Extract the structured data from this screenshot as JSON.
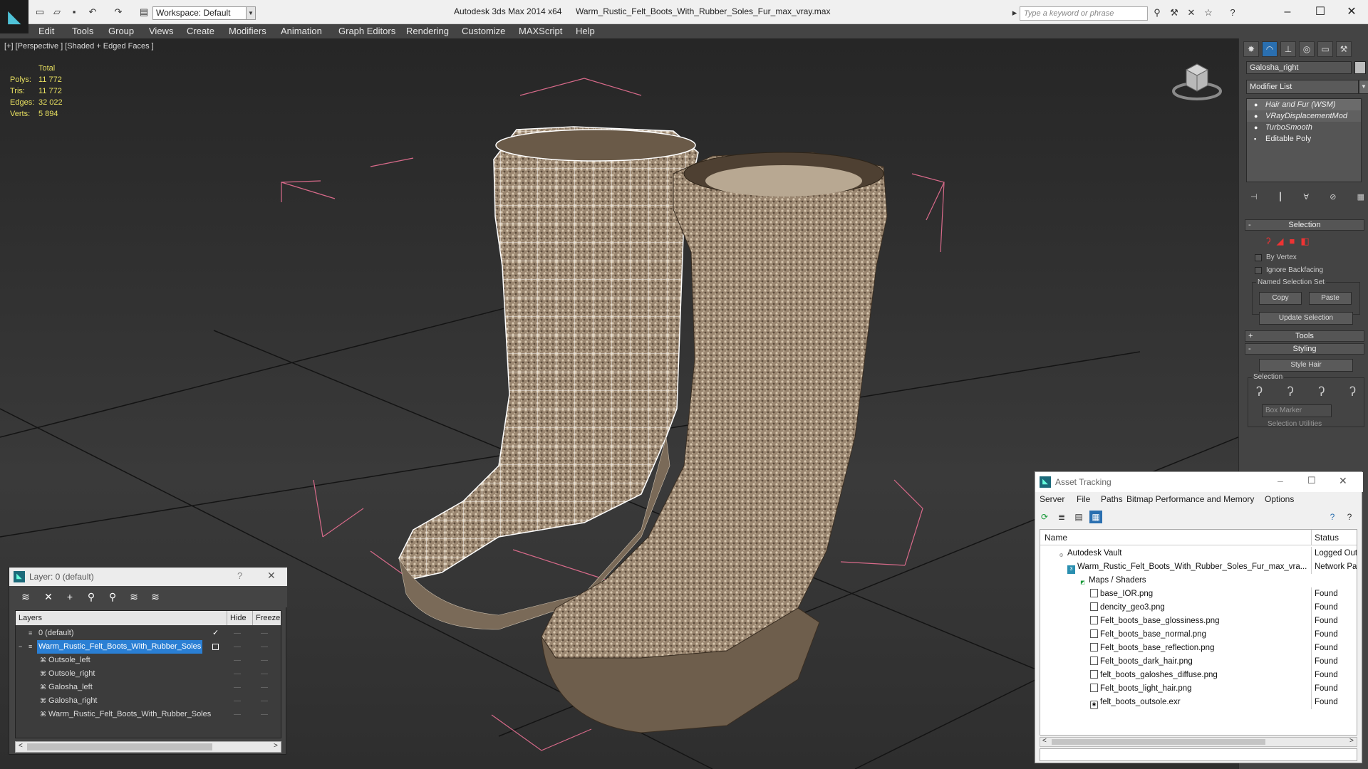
{
  "titlebar": {
    "app_title": "Autodesk 3ds Max  2014 x64",
    "doc_title": "Warm_Rustic_Felt_Boots_With_Rubber_Soles_Fur_max_vray.max",
    "workspace": "Workspace: Default",
    "search_placeholder": "Type a keyword or phrase"
  },
  "menu": [
    "Edit",
    "Tools",
    "Group",
    "Views",
    "Create",
    "Modifiers",
    "Animation",
    "Graph Editors",
    "Rendering",
    "Customize",
    "MAXScript",
    "Help"
  ],
  "viewport": {
    "label": "[+] [Perspective ] [Shaded + Edged Faces ]",
    "stats": {
      "header": "Total",
      "rows": [
        {
          "k": "Polys:",
          "v": "11 772"
        },
        {
          "k": "Tris:",
          "v": "11 772"
        },
        {
          "k": "Edges:",
          "v": "32 022"
        },
        {
          "k": "Verts:",
          "v": "5 894"
        }
      ]
    }
  },
  "command_panel": {
    "object_name": "Galosha_right",
    "modifier_list": "Modifier List",
    "stack": [
      {
        "label": "Hair and Fur (WSM)",
        "italic": true,
        "selected": true
      },
      {
        "label": "VRayDisplacementMod",
        "italic": true,
        "selected": false
      },
      {
        "label": "TurboSmooth",
        "italic": true,
        "selected": false
      },
      {
        "label": "Editable Poly",
        "italic": false,
        "selected": false
      }
    ],
    "selection_rollout": "Selection",
    "by_vertex": "By Vertex",
    "ignore_backfacing": "Ignore Backfacing",
    "named_selection_set": "Named Selection Set",
    "copy": "Copy",
    "paste": "Paste",
    "update_selection": "Update Selection",
    "tools_rollout": "Tools",
    "styling_rollout": "Styling",
    "style_hair": "Style Hair",
    "selection_group": "Selection",
    "box_marker": "Box Marker",
    "selection_utilities": "Selection Utilities"
  },
  "layer_dialog": {
    "title": "Layer: 0 (default)",
    "help": "?",
    "columns": {
      "layers": "Layers",
      "hide": "Hide",
      "freeze": "Freeze"
    },
    "rows": [
      {
        "name": "0 (default)",
        "indent": 1,
        "selected": false,
        "current": true
      },
      {
        "name": "Warm_Rustic_Felt_Boots_With_Rubber_Soles",
        "indent": 1,
        "selected": true,
        "current": false
      },
      {
        "name": "Outsole_left",
        "indent": 2,
        "selected": false,
        "current": false
      },
      {
        "name": "Outsole_right",
        "indent": 2,
        "selected": false,
        "current": false
      },
      {
        "name": "Galosha_left",
        "indent": 2,
        "selected": false,
        "current": false
      },
      {
        "name": "Galosha_right",
        "indent": 2,
        "selected": false,
        "current": false
      },
      {
        "name": "Warm_Rustic_Felt_Boots_With_Rubber_Soles",
        "indent": 2,
        "selected": false,
        "current": false
      }
    ]
  },
  "asset_tracking": {
    "title": "Asset Tracking",
    "menu": [
      "Server",
      "File",
      "Paths",
      "Bitmap Performance and Memory",
      "Options"
    ],
    "columns": {
      "name": "Name",
      "status": "Status"
    },
    "rows": [
      {
        "name": "Autodesk Vault",
        "indent": 1,
        "status": "Logged Out ..."
      },
      {
        "name": "Warm_Rustic_Felt_Boots_With_Rubber_Soles_Fur_max_vra...",
        "indent": 2,
        "status": "Network Path"
      },
      {
        "name": "Maps / Shaders",
        "indent": 3,
        "status": ""
      },
      {
        "name": "base_IOR.png",
        "indent": 4,
        "status": "Found"
      },
      {
        "name": "dencity_geo3.png",
        "indent": 4,
        "status": "Found"
      },
      {
        "name": "Felt_boots_base_glossiness.png",
        "indent": 4,
        "status": "Found"
      },
      {
        "name": "Felt_boots_base_normal.png",
        "indent": 4,
        "status": "Found"
      },
      {
        "name": "Felt_boots_base_reflection.png",
        "indent": 4,
        "status": "Found"
      },
      {
        "name": "Felt_boots_dark_hair.png",
        "indent": 4,
        "status": "Found"
      },
      {
        "name": "felt_boots_galoshes_diffuse.png",
        "indent": 4,
        "status": "Found"
      },
      {
        "name": "Felt_boots_light_hair.png",
        "indent": 4,
        "status": "Found"
      },
      {
        "name": "felt_boots_outsole.exr",
        "indent": 4,
        "status": "Found"
      }
    ]
  },
  "colors": {
    "accent_selection": "#2a7fd4",
    "stats_text": "#e8e060",
    "bbox_lines": "#d86a8a"
  }
}
